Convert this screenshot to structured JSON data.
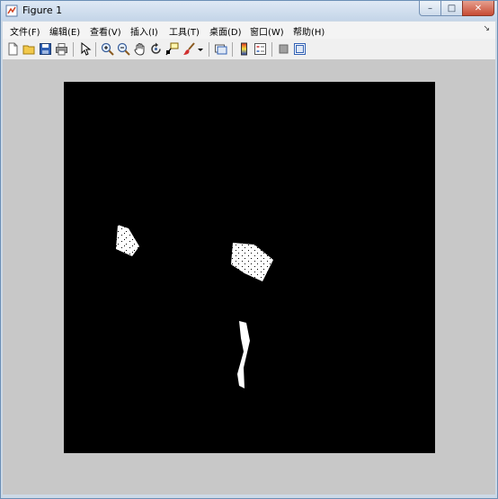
{
  "window": {
    "title": "Figure 1",
    "buttons": {
      "minimize": "–",
      "maximize": "□",
      "close": "✕"
    }
  },
  "menu": {
    "items": [
      {
        "label": "文件(F)"
      },
      {
        "label": "编辑(E)"
      },
      {
        "label": "查看(V)"
      },
      {
        "label": "插入(I)"
      },
      {
        "label": "工具(T)"
      },
      {
        "label": "桌面(D)"
      },
      {
        "label": "窗口(W)"
      },
      {
        "label": "帮助(H)"
      }
    ],
    "overflow_arrow": "↘"
  },
  "toolbar": {
    "tools": [
      {
        "name": "new-figure-icon"
      },
      {
        "name": "open-file-icon"
      },
      {
        "name": "save-icon"
      },
      {
        "name": "print-icon"
      },
      {
        "name": "edit-plot-arrow-icon"
      },
      {
        "name": "zoom-in-icon"
      },
      {
        "name": "zoom-out-icon"
      },
      {
        "name": "pan-hand-icon"
      },
      {
        "name": "rotate-3d-icon"
      },
      {
        "name": "data-cursor-icon"
      },
      {
        "name": "brush-icon"
      },
      {
        "name": "brush-dropdown-icon"
      },
      {
        "name": "link-plot-icon"
      },
      {
        "name": "colorbar-icon"
      },
      {
        "name": "legend-icon"
      },
      {
        "name": "hide-plot-tools-icon"
      },
      {
        "name": "show-plot-tools-icon"
      }
    ]
  },
  "colors": {
    "figure_background": "#c8c8c8",
    "axes_background": "#000000",
    "blob_color": "#ffffff"
  },
  "image": {
    "description": "binary image with three white regions on black"
  }
}
